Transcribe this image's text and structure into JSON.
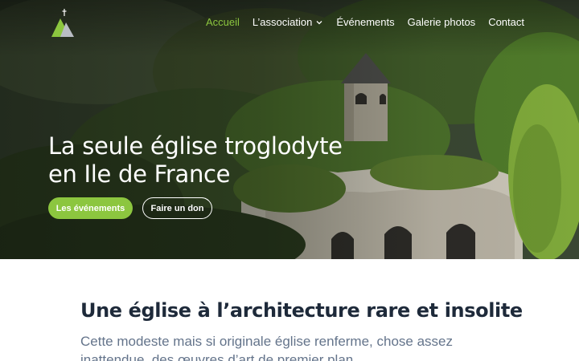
{
  "header": {
    "logo_icon": "church-mountain-logo-icon",
    "nav": [
      {
        "label": "Accueil",
        "active": true
      },
      {
        "label": "L’association",
        "has_dropdown": true
      },
      {
        "label": "Événements"
      },
      {
        "label": "Galerie photos"
      },
      {
        "label": "Contact"
      }
    ]
  },
  "hero": {
    "title_line1": "La seule église troglodyte",
    "title_line2": "en Ile de France",
    "primary_button": "Les événements",
    "secondary_button": "Faire un don"
  },
  "intro": {
    "title": "Une église à l’architecture rare et insolite",
    "text": "Cette modeste mais si originale église renferme, chose assez inattendue, des œuvres d’art de premier plan."
  },
  "colors": {
    "accent": "#8cc63f",
    "heading": "#1e2a3a",
    "body_text": "#64748b"
  }
}
